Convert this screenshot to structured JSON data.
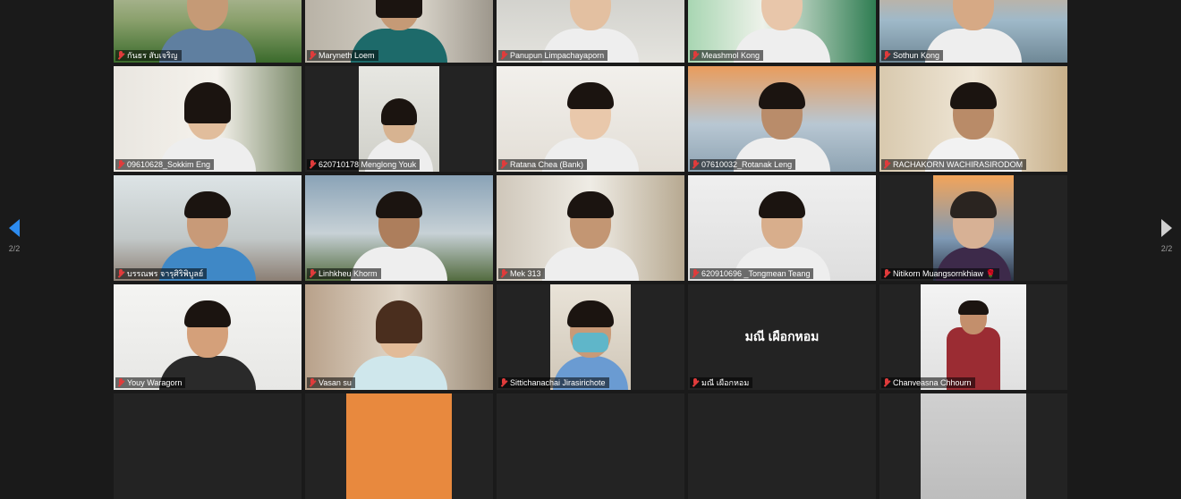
{
  "pagination": {
    "prev_page_text": "2/2",
    "next_page_text": "2/2"
  },
  "tiles": [
    {
      "name": "กันธร สับเจริญ",
      "muted": true,
      "video": true
    },
    {
      "name": "Maryneth Loem",
      "muted": true,
      "video": true
    },
    {
      "name": "Panupun Limpachayaporn",
      "muted": true,
      "video": true
    },
    {
      "name": "Meashmol Kong",
      "muted": true,
      "video": true
    },
    {
      "name": "Sothun Kong",
      "muted": true,
      "video": true
    },
    {
      "name": "09610628_Sokkim Eng",
      "muted": true,
      "video": true
    },
    {
      "name": "620710178 Menglong Youk",
      "muted": true,
      "video": true
    },
    {
      "name": "Ratana Chea (Bank)",
      "muted": true,
      "video": true
    },
    {
      "name": "07610032_Rotanak Leng",
      "muted": true,
      "video": true
    },
    {
      "name": "RACHAKORN WACHIRASIRODOM",
      "muted": true,
      "video": true
    },
    {
      "name": "บรรณพร จารุศิริพิบูลย์",
      "muted": true,
      "video": true
    },
    {
      "name": "Linhkheu Khorm",
      "muted": true,
      "video": true
    },
    {
      "name": "Mek 313",
      "muted": true,
      "video": true
    },
    {
      "name": "620910696 _Tongmean Teang",
      "muted": true,
      "video": true
    },
    {
      "name": "Nitikorn Muangsornkhiaw 🌹",
      "muted": true,
      "video": true
    },
    {
      "name": "Youy Waragorn",
      "muted": true,
      "video": true
    },
    {
      "name": "Vasan su",
      "muted": true,
      "video": true
    },
    {
      "name": "Sittichanachai Jirasirichote",
      "muted": true,
      "video": true
    },
    {
      "name": "มณี เผือกหอม",
      "muted": true,
      "video": false,
      "center_name": "มณี เผือกหอม"
    },
    {
      "name": "Chanveasna Chhourn",
      "muted": true,
      "video": true
    }
  ]
}
